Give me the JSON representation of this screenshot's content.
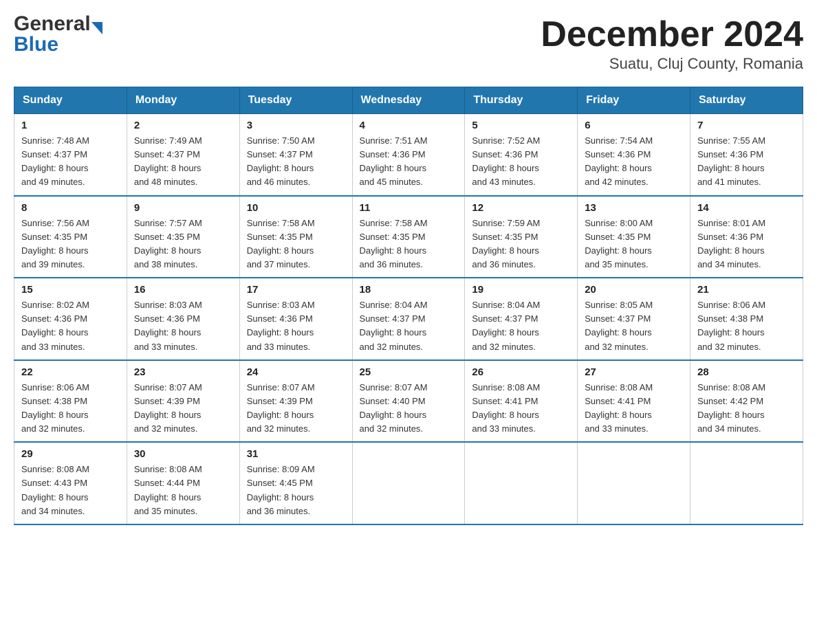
{
  "header": {
    "logo_general": "General",
    "logo_blue": "Blue",
    "title": "December 2024",
    "subtitle": "Suatu, Cluj County, Romania"
  },
  "days_of_week": [
    "Sunday",
    "Monday",
    "Tuesday",
    "Wednesday",
    "Thursday",
    "Friday",
    "Saturday"
  ],
  "weeks": [
    [
      {
        "day": "1",
        "sunrise": "7:48 AM",
        "sunset": "4:37 PM",
        "daylight": "8 hours and 49 minutes."
      },
      {
        "day": "2",
        "sunrise": "7:49 AM",
        "sunset": "4:37 PM",
        "daylight": "8 hours and 48 minutes."
      },
      {
        "day": "3",
        "sunrise": "7:50 AM",
        "sunset": "4:37 PM",
        "daylight": "8 hours and 46 minutes."
      },
      {
        "day": "4",
        "sunrise": "7:51 AM",
        "sunset": "4:36 PM",
        "daylight": "8 hours and 45 minutes."
      },
      {
        "day": "5",
        "sunrise": "7:52 AM",
        "sunset": "4:36 PM",
        "daylight": "8 hours and 43 minutes."
      },
      {
        "day": "6",
        "sunrise": "7:54 AM",
        "sunset": "4:36 PM",
        "daylight": "8 hours and 42 minutes."
      },
      {
        "day": "7",
        "sunrise": "7:55 AM",
        "sunset": "4:36 PM",
        "daylight": "8 hours and 41 minutes."
      }
    ],
    [
      {
        "day": "8",
        "sunrise": "7:56 AM",
        "sunset": "4:35 PM",
        "daylight": "8 hours and 39 minutes."
      },
      {
        "day": "9",
        "sunrise": "7:57 AM",
        "sunset": "4:35 PM",
        "daylight": "8 hours and 38 minutes."
      },
      {
        "day": "10",
        "sunrise": "7:58 AM",
        "sunset": "4:35 PM",
        "daylight": "8 hours and 37 minutes."
      },
      {
        "day": "11",
        "sunrise": "7:58 AM",
        "sunset": "4:35 PM",
        "daylight": "8 hours and 36 minutes."
      },
      {
        "day": "12",
        "sunrise": "7:59 AM",
        "sunset": "4:35 PM",
        "daylight": "8 hours and 36 minutes."
      },
      {
        "day": "13",
        "sunrise": "8:00 AM",
        "sunset": "4:35 PM",
        "daylight": "8 hours and 35 minutes."
      },
      {
        "day": "14",
        "sunrise": "8:01 AM",
        "sunset": "4:36 PM",
        "daylight": "8 hours and 34 minutes."
      }
    ],
    [
      {
        "day": "15",
        "sunrise": "8:02 AM",
        "sunset": "4:36 PM",
        "daylight": "8 hours and 33 minutes."
      },
      {
        "day": "16",
        "sunrise": "8:03 AM",
        "sunset": "4:36 PM",
        "daylight": "8 hours and 33 minutes."
      },
      {
        "day": "17",
        "sunrise": "8:03 AM",
        "sunset": "4:36 PM",
        "daylight": "8 hours and 33 minutes."
      },
      {
        "day": "18",
        "sunrise": "8:04 AM",
        "sunset": "4:37 PM",
        "daylight": "8 hours and 32 minutes."
      },
      {
        "day": "19",
        "sunrise": "8:04 AM",
        "sunset": "4:37 PM",
        "daylight": "8 hours and 32 minutes."
      },
      {
        "day": "20",
        "sunrise": "8:05 AM",
        "sunset": "4:37 PM",
        "daylight": "8 hours and 32 minutes."
      },
      {
        "day": "21",
        "sunrise": "8:06 AM",
        "sunset": "4:38 PM",
        "daylight": "8 hours and 32 minutes."
      }
    ],
    [
      {
        "day": "22",
        "sunrise": "8:06 AM",
        "sunset": "4:38 PM",
        "daylight": "8 hours and 32 minutes."
      },
      {
        "day": "23",
        "sunrise": "8:07 AM",
        "sunset": "4:39 PM",
        "daylight": "8 hours and 32 minutes."
      },
      {
        "day": "24",
        "sunrise": "8:07 AM",
        "sunset": "4:39 PM",
        "daylight": "8 hours and 32 minutes."
      },
      {
        "day": "25",
        "sunrise": "8:07 AM",
        "sunset": "4:40 PM",
        "daylight": "8 hours and 32 minutes."
      },
      {
        "day": "26",
        "sunrise": "8:08 AM",
        "sunset": "4:41 PM",
        "daylight": "8 hours and 33 minutes."
      },
      {
        "day": "27",
        "sunrise": "8:08 AM",
        "sunset": "4:41 PM",
        "daylight": "8 hours and 33 minutes."
      },
      {
        "day": "28",
        "sunrise": "8:08 AM",
        "sunset": "4:42 PM",
        "daylight": "8 hours and 34 minutes."
      }
    ],
    [
      {
        "day": "29",
        "sunrise": "8:08 AM",
        "sunset": "4:43 PM",
        "daylight": "8 hours and 34 minutes."
      },
      {
        "day": "30",
        "sunrise": "8:08 AM",
        "sunset": "4:44 PM",
        "daylight": "8 hours and 35 minutes."
      },
      {
        "day": "31",
        "sunrise": "8:09 AM",
        "sunset": "4:45 PM",
        "daylight": "8 hours and 36 minutes."
      },
      null,
      null,
      null,
      null
    ]
  ],
  "labels": {
    "sunrise": "Sunrise:",
    "sunset": "Sunset:",
    "daylight": "Daylight:"
  }
}
